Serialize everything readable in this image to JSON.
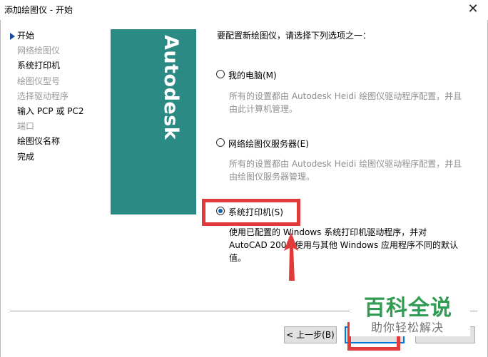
{
  "window": {
    "title": "添加绘图仪 - 开始",
    "close_glyph": "✕"
  },
  "steps": [
    {
      "label": "开始",
      "state": "current"
    },
    {
      "label": "网络绘图仪",
      "state": "disabled"
    },
    {
      "label": "系统打印机",
      "state": "enabled"
    },
    {
      "label": "绘图仪型号",
      "state": "disabled"
    },
    {
      "label": "选择驱动程序",
      "state": "disabled"
    },
    {
      "label": "输入 PCP 或 PC2",
      "state": "enabled"
    },
    {
      "label": "端口",
      "state": "disabled"
    },
    {
      "label": "绘图仪名称",
      "state": "enabled"
    },
    {
      "label": "完成",
      "state": "enabled"
    }
  ],
  "logo": {
    "text": "Autodesk",
    "color": "#2b8a84"
  },
  "main": {
    "prompt": "要配置新绘图仪，请选择下列选项之一：",
    "options": [
      {
        "label": "我的电脑(M)",
        "description": "所有的设置都由 Autodesk Heidi 绘图仪驱动程序配置，并且由此计算机管理。",
        "selected": false
      },
      {
        "label": "网络绘图仪服务器(E)",
        "description": "所有的设置都由 Autodesk Heidi 绘图仪驱动程序配置，并且由绘图仪服务器管理。",
        "selected": false
      },
      {
        "label": "系统打印机(S)",
        "description": "使用已配置的 Windows 系统打印机驱动程序，并对 AutoCAD 2007 使用与其他 Windows 应用程序不同的默认值。",
        "selected": true
      }
    ]
  },
  "footer": {
    "back_label": "< 上一步(B)",
    "next_label": "",
    "cancel_label": ""
  },
  "watermark": {
    "main": "百科全说",
    "sub": "助你轻松解决"
  },
  "annotation_color": "#e13a3a"
}
